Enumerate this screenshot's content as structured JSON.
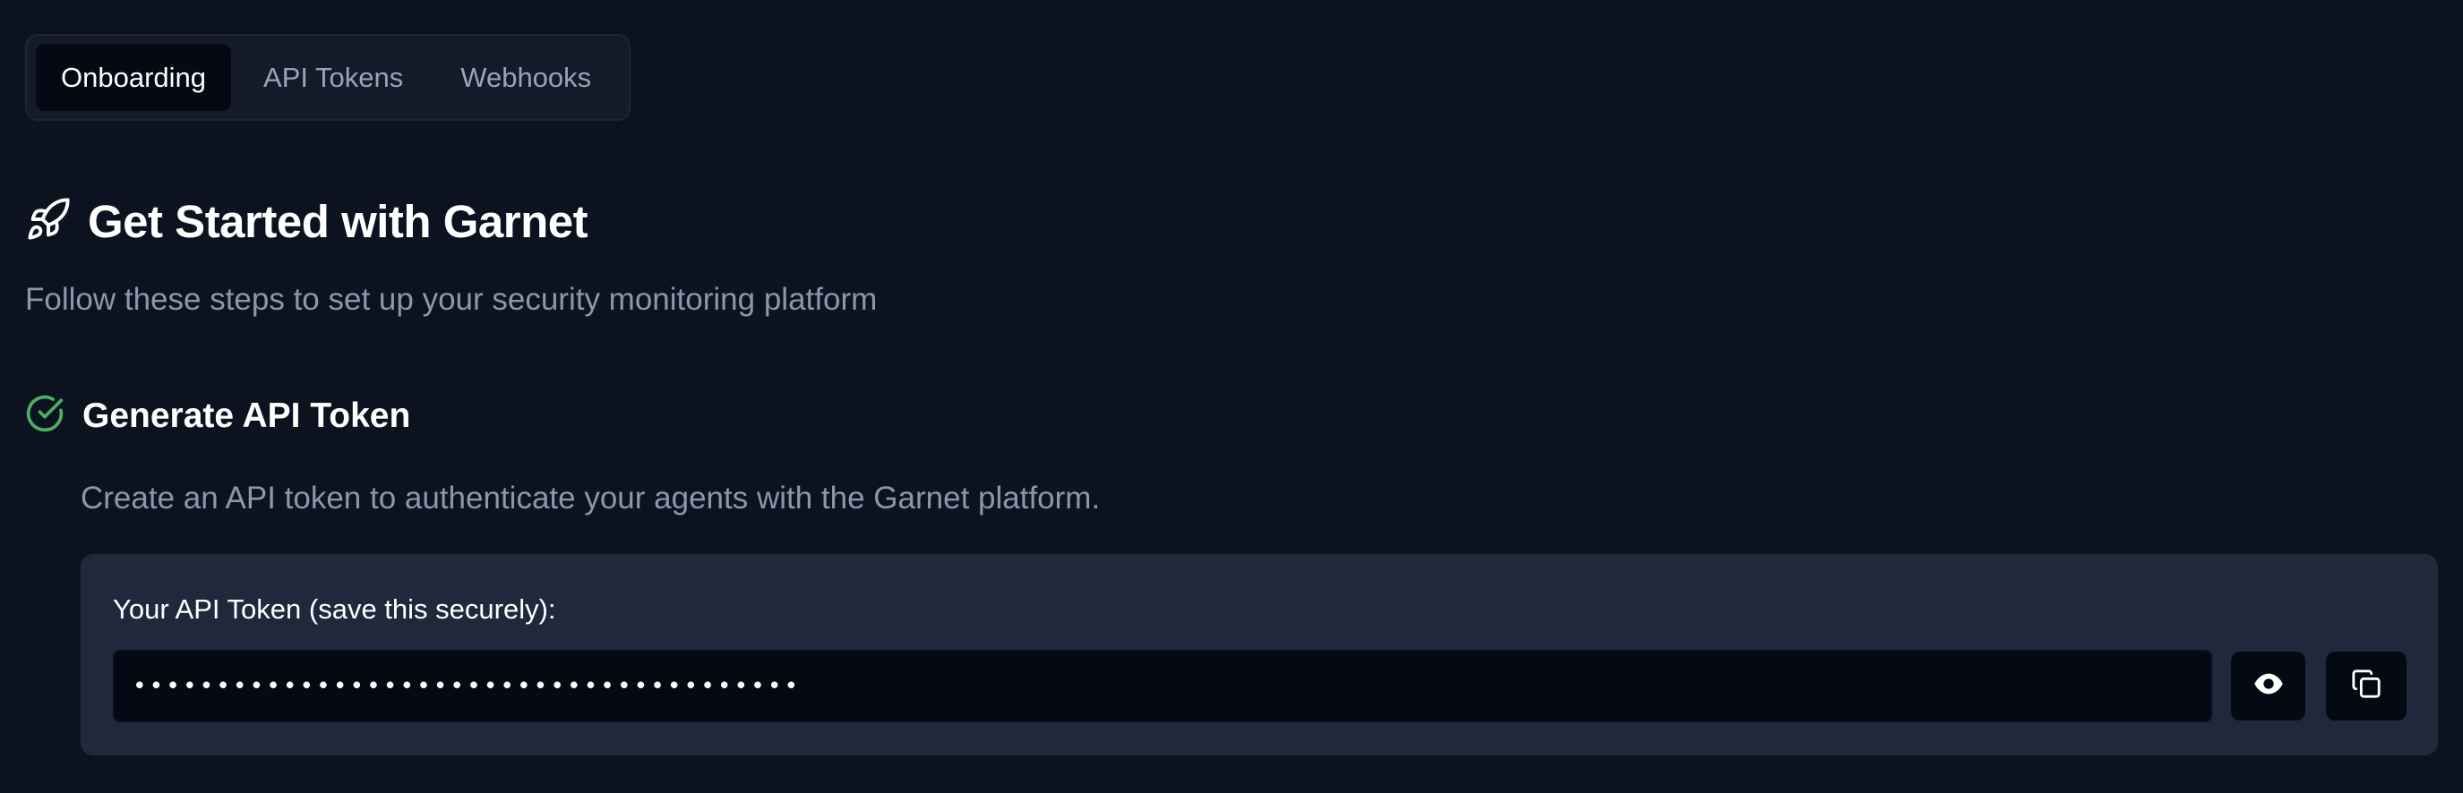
{
  "tabs": [
    {
      "label": "Onboarding",
      "active": true
    },
    {
      "label": "API Tokens",
      "active": false
    },
    {
      "label": "Webhooks",
      "active": false
    }
  ],
  "header": {
    "icon": "rocket-icon",
    "title": "Get Started with Garnet",
    "subtitle": "Follow these steps to set up your security monitoring platform"
  },
  "step": {
    "icon": "check-circle-icon",
    "title": "Generate API Token",
    "description": "Create an API token to authenticate your agents with the Garnet platform.",
    "token_label": "Your API Token (save this securely):",
    "token_value": "••••••••••••••••••••••••••••••••••••••••"
  },
  "colors": {
    "background": "#0d1220",
    "card": "#1f293b",
    "input": "#050914",
    "success": "#4caf63",
    "muted_text": "#8d96aa"
  }
}
